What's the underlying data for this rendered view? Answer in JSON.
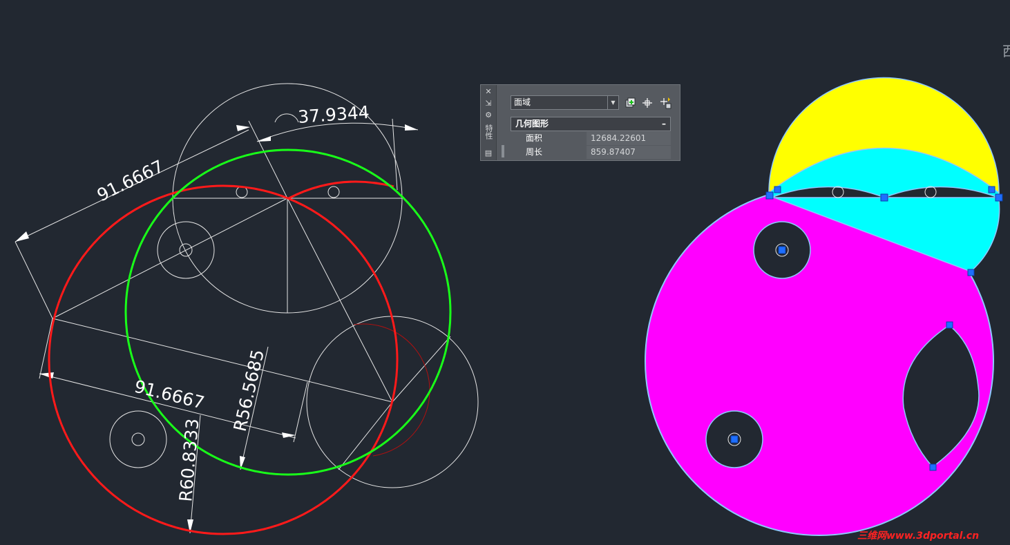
{
  "app": "CAD drawing workspace",
  "colors": {
    "background": "#222831",
    "circle_red": "#ff1a1a",
    "circle_green": "#19ff19",
    "geometry_white": "#e6e6e6",
    "region_magenta": "#ff00ff",
    "region_yellow": "#ffff00",
    "region_cyan": "#00ffff",
    "grip_blue": "#1e6fff"
  },
  "drawing": {
    "dimensions": {
      "top_linear": "91.6667",
      "arc_length": "37.9344",
      "bottom_linear": "91.6667",
      "radius_green": "R56.5685",
      "radius_red": "R60.8333"
    }
  },
  "properties_panel": {
    "strip_title": "特性",
    "object_type": "面域",
    "section": "几何图形",
    "collapse_symbol": "–",
    "rows": [
      {
        "label": "面积",
        "value": "12684.22601"
      },
      {
        "label": "周长",
        "value": "859.87407"
      }
    ],
    "icons": [
      "close-icon",
      "pin-icon",
      "settings-icon",
      "toggle-pickadd-icon",
      "select-objects-icon",
      "quick-select-icon"
    ]
  },
  "viewcube_label": "西",
  "watermark": "三维网www.3dportal.cn"
}
